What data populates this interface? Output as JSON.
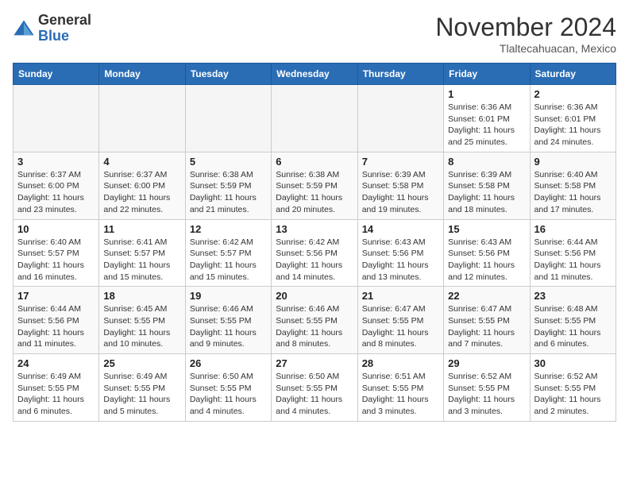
{
  "header": {
    "logo": {
      "general": "General",
      "blue": "Blue"
    },
    "month": "November 2024",
    "location": "Tlaltecahuacan, Mexico"
  },
  "days_of_week": [
    "Sunday",
    "Monday",
    "Tuesday",
    "Wednesday",
    "Thursday",
    "Friday",
    "Saturday"
  ],
  "weeks": [
    [
      {
        "day": "",
        "info": ""
      },
      {
        "day": "",
        "info": ""
      },
      {
        "day": "",
        "info": ""
      },
      {
        "day": "",
        "info": ""
      },
      {
        "day": "",
        "info": ""
      },
      {
        "day": "1",
        "info": "Sunrise: 6:36 AM\nSunset: 6:01 PM\nDaylight: 11 hours and 25 minutes."
      },
      {
        "day": "2",
        "info": "Sunrise: 6:36 AM\nSunset: 6:01 PM\nDaylight: 11 hours and 24 minutes."
      }
    ],
    [
      {
        "day": "3",
        "info": "Sunrise: 6:37 AM\nSunset: 6:00 PM\nDaylight: 11 hours and 23 minutes."
      },
      {
        "day": "4",
        "info": "Sunrise: 6:37 AM\nSunset: 6:00 PM\nDaylight: 11 hours and 22 minutes."
      },
      {
        "day": "5",
        "info": "Sunrise: 6:38 AM\nSunset: 5:59 PM\nDaylight: 11 hours and 21 minutes."
      },
      {
        "day": "6",
        "info": "Sunrise: 6:38 AM\nSunset: 5:59 PM\nDaylight: 11 hours and 20 minutes."
      },
      {
        "day": "7",
        "info": "Sunrise: 6:39 AM\nSunset: 5:58 PM\nDaylight: 11 hours and 19 minutes."
      },
      {
        "day": "8",
        "info": "Sunrise: 6:39 AM\nSunset: 5:58 PM\nDaylight: 11 hours and 18 minutes."
      },
      {
        "day": "9",
        "info": "Sunrise: 6:40 AM\nSunset: 5:58 PM\nDaylight: 11 hours and 17 minutes."
      }
    ],
    [
      {
        "day": "10",
        "info": "Sunrise: 6:40 AM\nSunset: 5:57 PM\nDaylight: 11 hours and 16 minutes."
      },
      {
        "day": "11",
        "info": "Sunrise: 6:41 AM\nSunset: 5:57 PM\nDaylight: 11 hours and 15 minutes."
      },
      {
        "day": "12",
        "info": "Sunrise: 6:42 AM\nSunset: 5:57 PM\nDaylight: 11 hours and 15 minutes."
      },
      {
        "day": "13",
        "info": "Sunrise: 6:42 AM\nSunset: 5:56 PM\nDaylight: 11 hours and 14 minutes."
      },
      {
        "day": "14",
        "info": "Sunrise: 6:43 AM\nSunset: 5:56 PM\nDaylight: 11 hours and 13 minutes."
      },
      {
        "day": "15",
        "info": "Sunrise: 6:43 AM\nSunset: 5:56 PM\nDaylight: 11 hours and 12 minutes."
      },
      {
        "day": "16",
        "info": "Sunrise: 6:44 AM\nSunset: 5:56 PM\nDaylight: 11 hours and 11 minutes."
      }
    ],
    [
      {
        "day": "17",
        "info": "Sunrise: 6:44 AM\nSunset: 5:56 PM\nDaylight: 11 hours and 11 minutes."
      },
      {
        "day": "18",
        "info": "Sunrise: 6:45 AM\nSunset: 5:55 PM\nDaylight: 11 hours and 10 minutes."
      },
      {
        "day": "19",
        "info": "Sunrise: 6:46 AM\nSunset: 5:55 PM\nDaylight: 11 hours and 9 minutes."
      },
      {
        "day": "20",
        "info": "Sunrise: 6:46 AM\nSunset: 5:55 PM\nDaylight: 11 hours and 8 minutes."
      },
      {
        "day": "21",
        "info": "Sunrise: 6:47 AM\nSunset: 5:55 PM\nDaylight: 11 hours and 8 minutes."
      },
      {
        "day": "22",
        "info": "Sunrise: 6:47 AM\nSunset: 5:55 PM\nDaylight: 11 hours and 7 minutes."
      },
      {
        "day": "23",
        "info": "Sunrise: 6:48 AM\nSunset: 5:55 PM\nDaylight: 11 hours and 6 minutes."
      }
    ],
    [
      {
        "day": "24",
        "info": "Sunrise: 6:49 AM\nSunset: 5:55 PM\nDaylight: 11 hours and 6 minutes."
      },
      {
        "day": "25",
        "info": "Sunrise: 6:49 AM\nSunset: 5:55 PM\nDaylight: 11 hours and 5 minutes."
      },
      {
        "day": "26",
        "info": "Sunrise: 6:50 AM\nSunset: 5:55 PM\nDaylight: 11 hours and 4 minutes."
      },
      {
        "day": "27",
        "info": "Sunrise: 6:50 AM\nSunset: 5:55 PM\nDaylight: 11 hours and 4 minutes."
      },
      {
        "day": "28",
        "info": "Sunrise: 6:51 AM\nSunset: 5:55 PM\nDaylight: 11 hours and 3 minutes."
      },
      {
        "day": "29",
        "info": "Sunrise: 6:52 AM\nSunset: 5:55 PM\nDaylight: 11 hours and 3 minutes."
      },
      {
        "day": "30",
        "info": "Sunrise: 6:52 AM\nSunset: 5:55 PM\nDaylight: 11 hours and 2 minutes."
      }
    ]
  ]
}
